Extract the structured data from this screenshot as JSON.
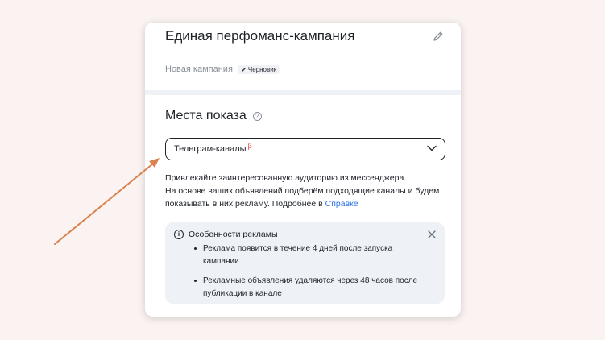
{
  "campaign": {
    "title": "Единая перфоманс-кампания",
    "type": "Новая кампания",
    "status_badge": "Черновик",
    "edit_icon": "pencil-icon"
  },
  "placements": {
    "title": "Места показа",
    "help_icon": "question-circle-icon",
    "select": {
      "value": "Телеграм-каналы",
      "badge": "β",
      "icon": "chevron-down-icon"
    },
    "description_line1": "Привлекайте заинтересованную аудиторию из мессенджера.",
    "description_line2": "На основе ваших объявлений подберём подходящие каналы и будем показывать в них рекламу. Подробнее в ",
    "description_link": "Справке"
  },
  "notice": {
    "title": "Особенности рекламы",
    "icon": "info-icon",
    "close_icon": "close-icon",
    "items": [
      "Реклама появится в течение 4 дней после запуска кампании",
      "Рекламные объявления удаляются через 48 часов после публикации в канале"
    ]
  },
  "colors": {
    "background": "#fbf3f1",
    "link": "#2e73e6",
    "beta": "#e5473c",
    "arrow": "#d9824e",
    "notice_bg": "#eef1f6"
  }
}
